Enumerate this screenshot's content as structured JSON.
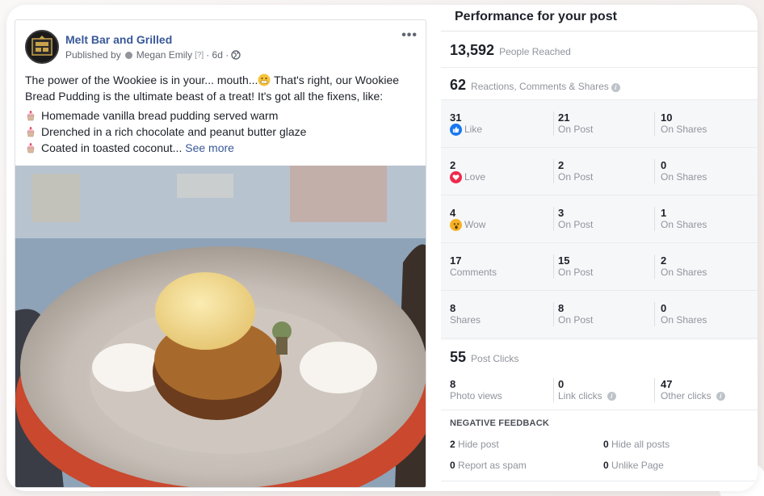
{
  "post": {
    "page_name": "Melt Bar and Grilled",
    "byline_prefix": "Published by",
    "author": "Megan Emily",
    "help_marker": "[?]",
    "time": "· 6d ·",
    "more": "•••",
    "intro_line": "The power of the Wookiee is in your... mouth...",
    "intro_rest": " That's right, our Wookiee Bread Pudding is the ultimate beast of a treat! It's got all the fixens, like:",
    "bullets": [
      "Homemade vanilla bread pudding served warm",
      "Drenched in a rich chocolate and peanut butter glaze",
      "Coated in toasted coconut..."
    ],
    "see_more": "See more"
  },
  "panel": {
    "title": "Performance for your post",
    "reach": {
      "value": "13,592",
      "label": "People Reached"
    },
    "engagement": {
      "value": "62",
      "label": "Reactions, Comments & Shares"
    },
    "rows": [
      {
        "total": "31",
        "name": "Like",
        "icon": "like-icon",
        "on_post": "21",
        "on_post_label": "On Post",
        "on_shares": "10",
        "on_shares_label": "On Shares"
      },
      {
        "total": "2",
        "name": "Love",
        "icon": "love-icon",
        "on_post": "2",
        "on_post_label": "On Post",
        "on_shares": "0",
        "on_shares_label": "On Shares"
      },
      {
        "total": "4",
        "name": "Wow",
        "icon": "wow-icon",
        "on_post": "3",
        "on_post_label": "On Post",
        "on_shares": "1",
        "on_shares_label": "On Shares"
      },
      {
        "total": "17",
        "name": "Comments",
        "on_post": "15",
        "on_post_label": "On Post",
        "on_shares": "2",
        "on_shares_label": "On Shares"
      },
      {
        "total": "8",
        "name": "Shares",
        "on_post": "8",
        "on_post_label": "On Post",
        "on_shares": "0",
        "on_shares_label": "On Shares"
      }
    ],
    "clicks": {
      "value": "55",
      "label": "Post Clicks",
      "photo_views": "8",
      "photo_views_label": "Photo views",
      "link_clicks": "0",
      "link_clicks_label": "Link clicks",
      "other_clicks": "47",
      "other_clicks_label": "Other clicks"
    },
    "negative": {
      "title": "NEGATIVE FEEDBACK",
      "hide_post": "2",
      "hide_post_label": "Hide post",
      "hide_all": "0",
      "hide_all_label": "Hide all posts",
      "spam": "0",
      "spam_label": "Report as spam",
      "unlike": "0",
      "unlike_label": "Unlike Page"
    }
  },
  "colors": {
    "link": "#385898",
    "muted": "#90949c",
    "like": "#1877f2",
    "love": "#f0284a",
    "wow": "#f7b125"
  }
}
